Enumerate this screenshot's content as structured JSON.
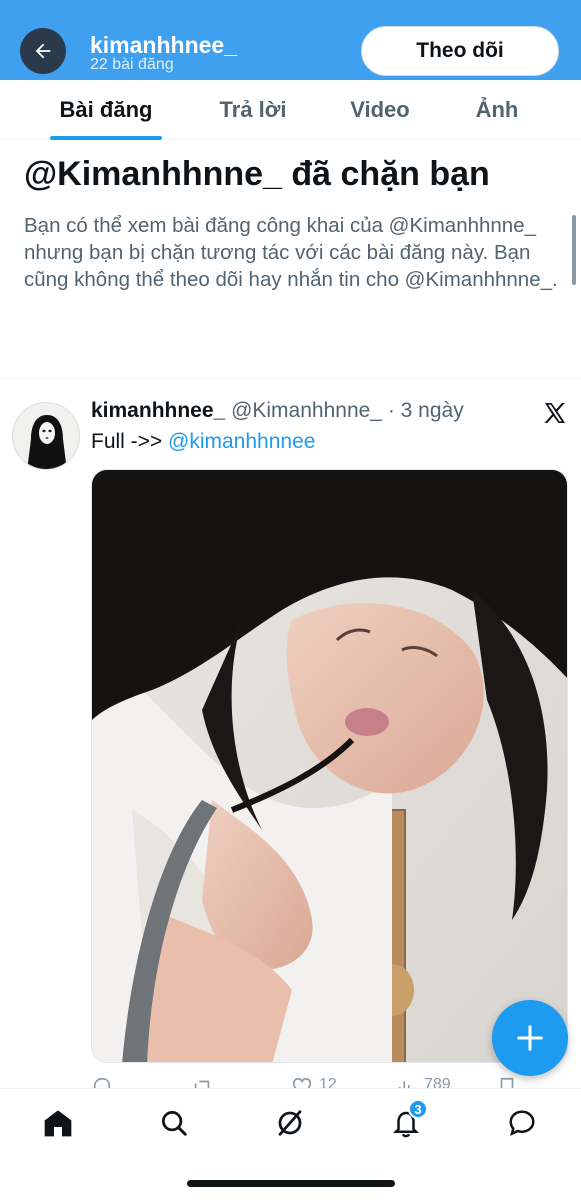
{
  "header": {
    "back_icon": "arrow-left-icon",
    "title": "kimanhhnee_",
    "subtitle": "22 bài đăng",
    "follow_label": "Theo dõi",
    "bg_color": "#3fa0ef"
  },
  "tabs": [
    {
      "label": "Bài đăng",
      "active": true
    },
    {
      "label": "Trả lời",
      "active": false
    },
    {
      "label": "Video",
      "active": false
    },
    {
      "label": "Ảnh",
      "active": false
    }
  ],
  "blocked": {
    "title": "@Kimanhhnne_ đã chặn bạn",
    "body": "Bạn có thể xem bài đăng công khai của @Kimanhhnne_ nhưng bạn bị chặn tương tác với các bài đăng này. Bạn cũng không thể theo dõi hay nhắn tin cho @Kimanhhnne_."
  },
  "post": {
    "author_name": "kimanhhnee_",
    "author_handle": "@Kimanhhnne_",
    "separator": "·",
    "time": "3 ngày",
    "text_prefix": "Full ->> ",
    "text_link": "@kimanhhnnee",
    "source_icon": "x-logo-icon",
    "actions": {
      "reply_icon": "reply-icon",
      "repost_icon": "repost-icon",
      "like_icon": "heart-icon",
      "like_count": "12",
      "views_icon": "views-icon",
      "views_count": "789",
      "bookmark_icon": "bookmark-icon"
    }
  },
  "fab": {
    "icon": "plus-icon"
  },
  "bottom_nav": {
    "items": [
      "home-icon",
      "search-icon",
      "grok-icon",
      "bell-icon",
      "message-icon"
    ],
    "notification_badge": "3"
  },
  "colors": {
    "accent": "#1d9bf0",
    "text": "#0f1419",
    "muted": "#536471"
  }
}
